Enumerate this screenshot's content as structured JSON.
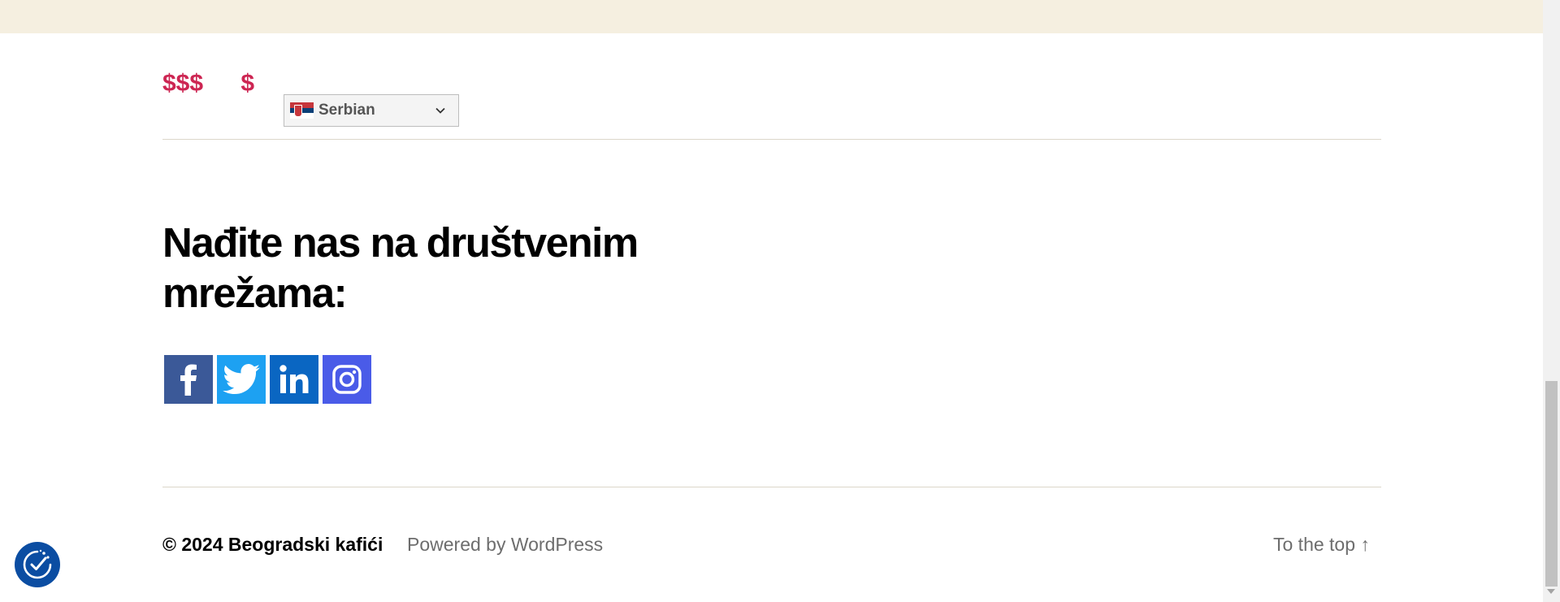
{
  "prices": {
    "high": "$$$",
    "low": "$"
  },
  "language_select": {
    "selected": "Serbian",
    "flag_icon": "serbia-flag-icon"
  },
  "social_section": {
    "heading": "Nađite nas na društvenim mrežama:",
    "links": [
      {
        "network": "Facebook",
        "icon": "facebook-icon",
        "color": "#3b5998"
      },
      {
        "network": "Twitter",
        "icon": "twitter-icon",
        "color": "#1da1f2"
      },
      {
        "network": "LinkedIn",
        "icon": "linkedin-icon",
        "color": "#0a66c2"
      },
      {
        "network": "Instagram",
        "icon": "instagram-icon",
        "color": "#4a5be8"
      }
    ]
  },
  "footer": {
    "copyright": "© 2024 Beogradski kafići",
    "powered_by": "Powered by WordPress",
    "to_top": "To the top ↑"
  },
  "colors": {
    "accent": "#cd2653",
    "top_band": "#f5efe0",
    "divider": "#dcd7ca",
    "cookie_button": "#0b4da2"
  }
}
